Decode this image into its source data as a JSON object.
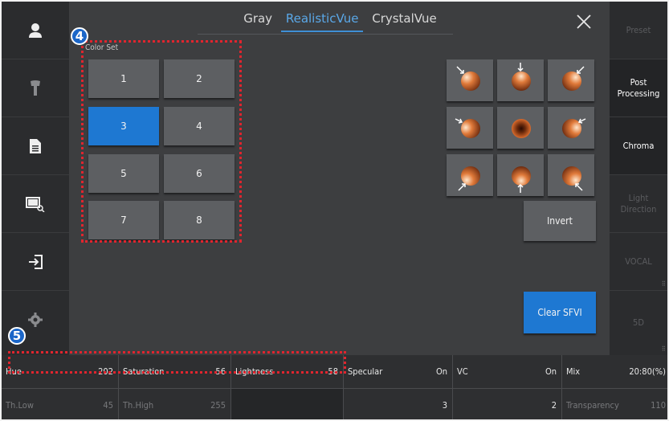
{
  "left_sidebar": {
    "items": [
      {
        "icon": "patient-icon"
      },
      {
        "icon": "probe-icon"
      },
      {
        "icon": "report-icon"
      },
      {
        "icon": "image-review-icon"
      },
      {
        "icon": "exit-icon"
      },
      {
        "icon": "settings-icon"
      }
    ]
  },
  "tabs": [
    {
      "label": "Gray",
      "active": false
    },
    {
      "label": "RealisticVue",
      "active": true
    },
    {
      "label": "CrystalVue",
      "active": false
    }
  ],
  "color_set": {
    "label": "Color Set",
    "buttons": [
      "1",
      "2",
      "3",
      "4",
      "5",
      "6",
      "7",
      "8"
    ],
    "selected": "3"
  },
  "light_direction_buttons": [
    "top-left",
    "top",
    "top-right",
    "left",
    "center",
    "right",
    "bottom-left",
    "bottom",
    "bottom-right"
  ],
  "buttons": {
    "invert": "Invert",
    "clear_sfvi": "Clear SFVI"
  },
  "annotations": {
    "badge_4": "4",
    "badge_5": "5"
  },
  "right_sidebar": {
    "items": [
      {
        "label": "Preset",
        "state": "disabled"
      },
      {
        "label": "Post Processing",
        "state": "active"
      },
      {
        "label": "Chroma",
        "state": "active"
      },
      {
        "label": "Light Direction",
        "state": "disabled"
      },
      {
        "label": "VOCAL",
        "state": "disabled"
      },
      {
        "label": "5D",
        "state": "disabled"
      }
    ]
  },
  "params": {
    "row1": [
      {
        "label": "Hue",
        "value": "202"
      },
      {
        "label": "Saturation",
        "value": "56"
      },
      {
        "label": "Lightness",
        "value": "58"
      },
      {
        "label": "Specular",
        "value": "On"
      },
      {
        "label": "VC",
        "value": "On"
      },
      {
        "label": "Mix",
        "value": "20:80(%)"
      }
    ],
    "row2": [
      {
        "label": "Th.Low",
        "value": "45"
      },
      {
        "label": "Th.High",
        "value": "255"
      },
      {
        "label": "",
        "value": ""
      },
      {
        "label": "",
        "value": "3"
      },
      {
        "label": "",
        "value": "2"
      },
      {
        "label": "Transparency",
        "value": "110"
      }
    ]
  },
  "colors": {
    "accent_blue": "#1e78d2",
    "highlight_dotted": "#e0252e",
    "button_gray": "#5d5f62"
  }
}
